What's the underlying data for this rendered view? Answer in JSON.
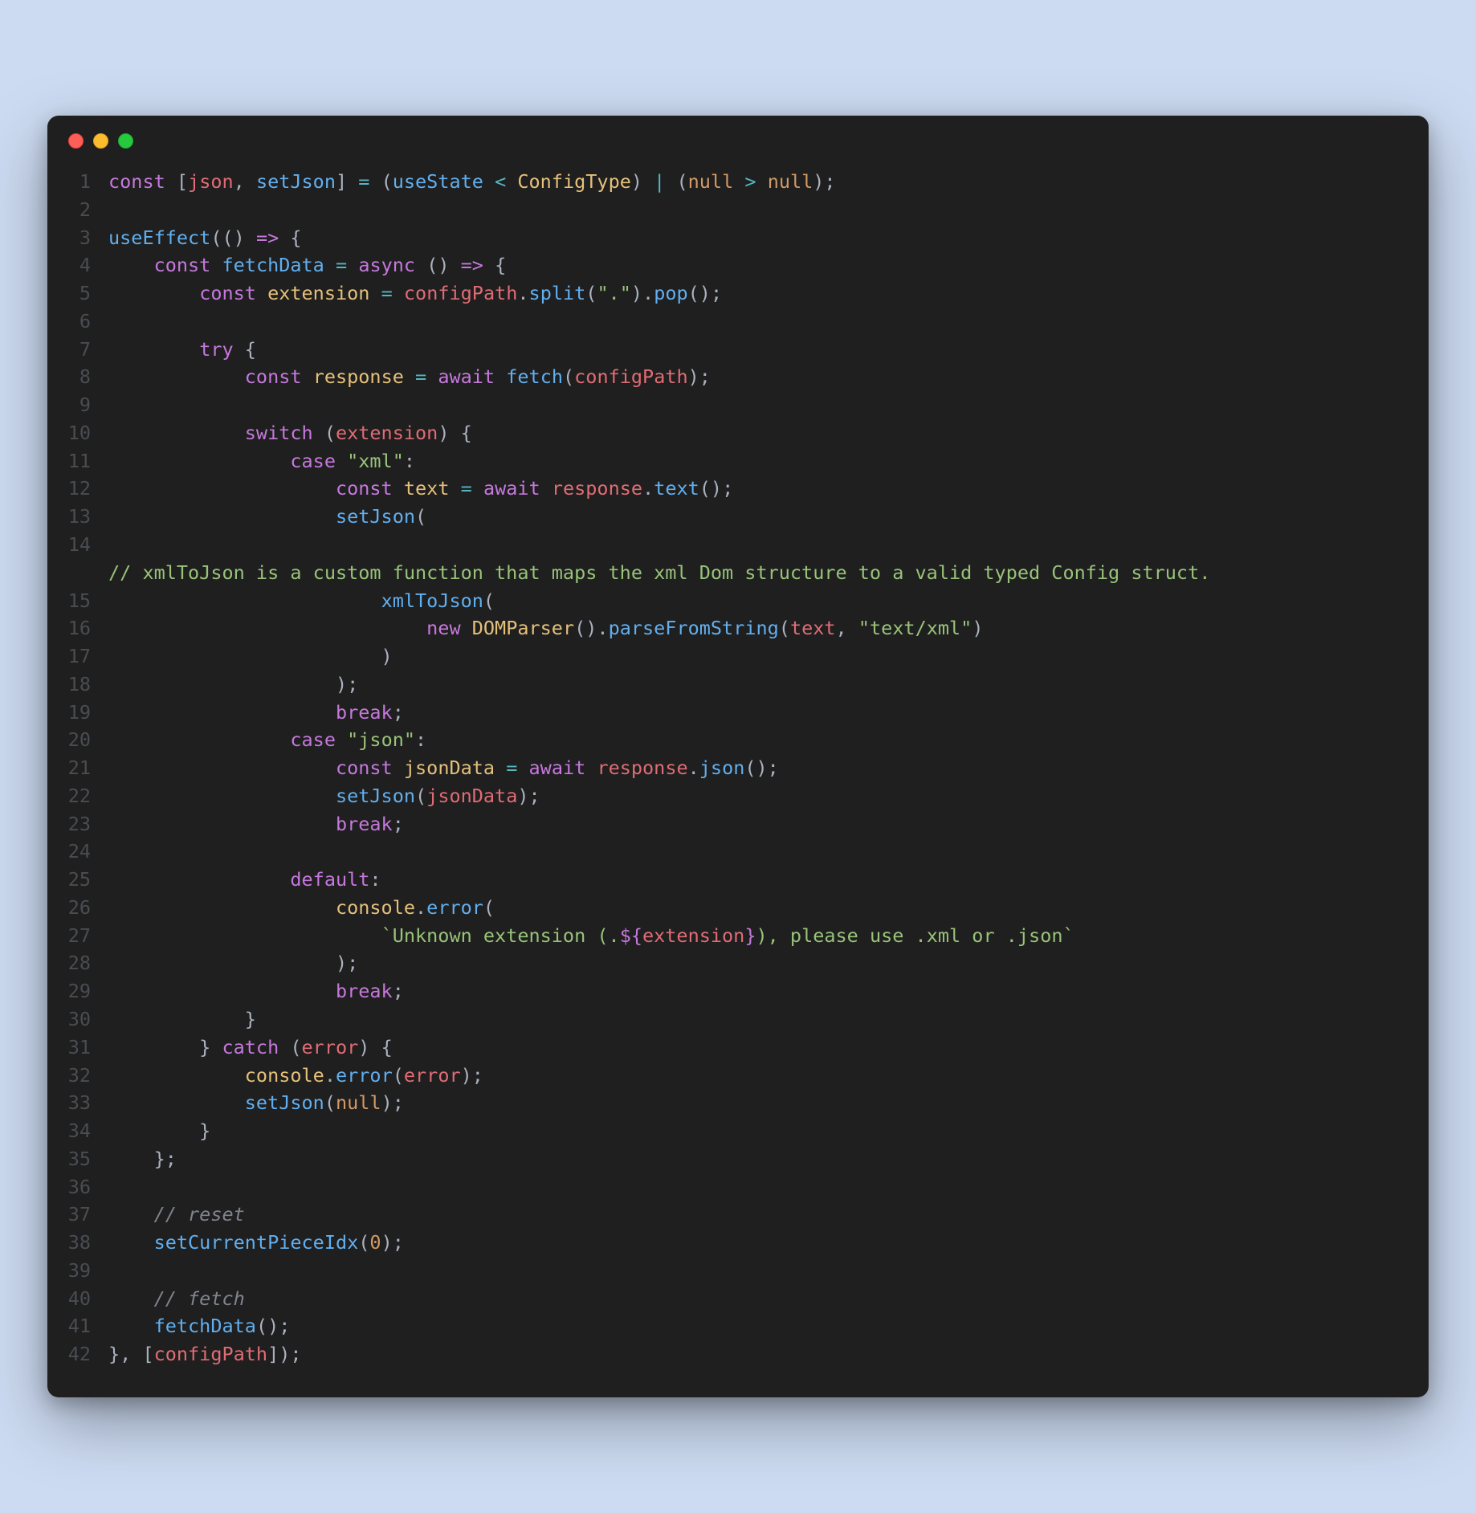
{
  "window": {
    "traffic": {
      "red": "#fb5f57",
      "yellow": "#fdbc2e",
      "green": "#27c93f"
    }
  },
  "code": {
    "lines": [
      {
        "n": "1",
        "tokens": [
          {
            "c": "kw",
            "t": "const"
          },
          {
            "c": "pn",
            "t": " ["
          },
          {
            "c": "red",
            "t": "json"
          },
          {
            "c": "pn",
            "t": ", "
          },
          {
            "c": "fn",
            "t": "setJson"
          },
          {
            "c": "pn",
            "t": "] "
          },
          {
            "c": "op",
            "t": "="
          },
          {
            "c": "pn",
            "t": " ("
          },
          {
            "c": "fn",
            "t": "useState"
          },
          {
            "c": "pn",
            "t": " "
          },
          {
            "c": "op",
            "t": "<"
          },
          {
            "c": "pn",
            "t": " "
          },
          {
            "c": "id",
            "t": "ConfigType"
          },
          {
            "c": "pn",
            "t": ") "
          },
          {
            "c": "op",
            "t": "|"
          },
          {
            "c": "pn",
            "t": " ("
          },
          {
            "c": "num",
            "t": "null"
          },
          {
            "c": "pn",
            "t": " "
          },
          {
            "c": "op",
            "t": ">"
          },
          {
            "c": "pn",
            "t": " "
          },
          {
            "c": "num",
            "t": "null"
          },
          {
            "c": "pn",
            "t": ");"
          }
        ]
      },
      {
        "n": "2",
        "tokens": [
          {
            "c": "pn",
            "t": ""
          }
        ]
      },
      {
        "n": "3",
        "tokens": [
          {
            "c": "fn",
            "t": "useEffect"
          },
          {
            "c": "pn",
            "t": "(() "
          },
          {
            "c": "kw",
            "t": "=>"
          },
          {
            "c": "pn",
            "t": " {"
          }
        ]
      },
      {
        "n": "4",
        "tokens": [
          {
            "c": "pn",
            "t": "    "
          },
          {
            "c": "kw",
            "t": "const"
          },
          {
            "c": "pn",
            "t": " "
          },
          {
            "c": "fn",
            "t": "fetchData"
          },
          {
            "c": "pn",
            "t": " "
          },
          {
            "c": "op",
            "t": "="
          },
          {
            "c": "pn",
            "t": " "
          },
          {
            "c": "kw",
            "t": "async"
          },
          {
            "c": "pn",
            "t": " () "
          },
          {
            "c": "kw",
            "t": "=>"
          },
          {
            "c": "pn",
            "t": " {"
          }
        ]
      },
      {
        "n": "5",
        "tokens": [
          {
            "c": "pn",
            "t": "        "
          },
          {
            "c": "kw",
            "t": "const"
          },
          {
            "c": "pn",
            "t": " "
          },
          {
            "c": "id",
            "t": "extension"
          },
          {
            "c": "pn",
            "t": " "
          },
          {
            "c": "op",
            "t": "="
          },
          {
            "c": "pn",
            "t": " "
          },
          {
            "c": "red",
            "t": "configPath"
          },
          {
            "c": "pn",
            "t": "."
          },
          {
            "c": "fn",
            "t": "split"
          },
          {
            "c": "pn",
            "t": "("
          },
          {
            "c": "str",
            "t": "\".\""
          },
          {
            "c": "pn",
            "t": ")."
          },
          {
            "c": "fn",
            "t": "pop"
          },
          {
            "c": "pn",
            "t": "();"
          }
        ]
      },
      {
        "n": "6",
        "tokens": [
          {
            "c": "pn",
            "t": ""
          }
        ]
      },
      {
        "n": "7",
        "tokens": [
          {
            "c": "pn",
            "t": "        "
          },
          {
            "c": "kw",
            "t": "try"
          },
          {
            "c": "pn",
            "t": " {"
          }
        ]
      },
      {
        "n": "8",
        "tokens": [
          {
            "c": "pn",
            "t": "            "
          },
          {
            "c": "kw",
            "t": "const"
          },
          {
            "c": "pn",
            "t": " "
          },
          {
            "c": "id",
            "t": "response"
          },
          {
            "c": "pn",
            "t": " "
          },
          {
            "c": "op",
            "t": "="
          },
          {
            "c": "pn",
            "t": " "
          },
          {
            "c": "kw",
            "t": "await"
          },
          {
            "c": "pn",
            "t": " "
          },
          {
            "c": "fn",
            "t": "fetch"
          },
          {
            "c": "pn",
            "t": "("
          },
          {
            "c": "red",
            "t": "configPath"
          },
          {
            "c": "pn",
            "t": ");"
          }
        ]
      },
      {
        "n": "9",
        "tokens": [
          {
            "c": "pn",
            "t": ""
          }
        ]
      },
      {
        "n": "10",
        "tokens": [
          {
            "c": "pn",
            "t": "            "
          },
          {
            "c": "kw",
            "t": "switch"
          },
          {
            "c": "pn",
            "t": " ("
          },
          {
            "c": "red",
            "t": "extension"
          },
          {
            "c": "pn",
            "t": ") {"
          }
        ]
      },
      {
        "n": "11",
        "tokens": [
          {
            "c": "pn",
            "t": "                "
          },
          {
            "c": "kw",
            "t": "case"
          },
          {
            "c": "pn",
            "t": " "
          },
          {
            "c": "str",
            "t": "\"xml\""
          },
          {
            "c": "pn",
            "t": ":"
          }
        ]
      },
      {
        "n": "12",
        "tokens": [
          {
            "c": "pn",
            "t": "                    "
          },
          {
            "c": "kw",
            "t": "const"
          },
          {
            "c": "pn",
            "t": " "
          },
          {
            "c": "id",
            "t": "text"
          },
          {
            "c": "pn",
            "t": " "
          },
          {
            "c": "op",
            "t": "="
          },
          {
            "c": "pn",
            "t": " "
          },
          {
            "c": "kw",
            "t": "await"
          },
          {
            "c": "pn",
            "t": " "
          },
          {
            "c": "red",
            "t": "response"
          },
          {
            "c": "pn",
            "t": "."
          },
          {
            "c": "fn",
            "t": "text"
          },
          {
            "c": "pn",
            "t": "();"
          }
        ]
      },
      {
        "n": "13",
        "tokens": [
          {
            "c": "pn",
            "t": "                    "
          },
          {
            "c": "fn",
            "t": "setJson"
          },
          {
            "c": "pn",
            "t": "("
          }
        ]
      },
      {
        "n": "14",
        "tokens": [
          {
            "c": "pn",
            "t": ""
          }
        ]
      },
      {
        "comment": true,
        "tokens": [
          {
            "c": "cm2",
            "t": "// xmlToJson is a custom function that maps the xml Dom structure to a valid typed Config struct."
          }
        ]
      },
      {
        "n": "15",
        "tokens": [
          {
            "c": "pn",
            "t": "                        "
          },
          {
            "c": "fn",
            "t": "xmlToJson"
          },
          {
            "c": "pn",
            "t": "("
          }
        ]
      },
      {
        "n": "16",
        "tokens": [
          {
            "c": "pn",
            "t": "                            "
          },
          {
            "c": "kw",
            "t": "new"
          },
          {
            "c": "pn",
            "t": " "
          },
          {
            "c": "id",
            "t": "DOMParser"
          },
          {
            "c": "pn",
            "t": "()."
          },
          {
            "c": "fn",
            "t": "parseFromString"
          },
          {
            "c": "pn",
            "t": "("
          },
          {
            "c": "red",
            "t": "text"
          },
          {
            "c": "pn",
            "t": ", "
          },
          {
            "c": "str",
            "t": "\"text/xml\""
          },
          {
            "c": "pn",
            "t": ")"
          }
        ]
      },
      {
        "n": "17",
        "tokens": [
          {
            "c": "pn",
            "t": "                        )"
          }
        ]
      },
      {
        "n": "18",
        "tokens": [
          {
            "c": "pn",
            "t": "                    );"
          }
        ]
      },
      {
        "n": "19",
        "tokens": [
          {
            "c": "pn",
            "t": "                    "
          },
          {
            "c": "kw",
            "t": "break"
          },
          {
            "c": "pn",
            "t": ";"
          }
        ]
      },
      {
        "n": "20",
        "tokens": [
          {
            "c": "pn",
            "t": "                "
          },
          {
            "c": "kw",
            "t": "case"
          },
          {
            "c": "pn",
            "t": " "
          },
          {
            "c": "str",
            "t": "\"json\""
          },
          {
            "c": "pn",
            "t": ":"
          }
        ]
      },
      {
        "n": "21",
        "tokens": [
          {
            "c": "pn",
            "t": "                    "
          },
          {
            "c": "kw",
            "t": "const"
          },
          {
            "c": "pn",
            "t": " "
          },
          {
            "c": "id",
            "t": "jsonData"
          },
          {
            "c": "pn",
            "t": " "
          },
          {
            "c": "op",
            "t": "="
          },
          {
            "c": "pn",
            "t": " "
          },
          {
            "c": "kw",
            "t": "await"
          },
          {
            "c": "pn",
            "t": " "
          },
          {
            "c": "red",
            "t": "response"
          },
          {
            "c": "pn",
            "t": "."
          },
          {
            "c": "fn",
            "t": "json"
          },
          {
            "c": "pn",
            "t": "();"
          }
        ]
      },
      {
        "n": "22",
        "tokens": [
          {
            "c": "pn",
            "t": "                    "
          },
          {
            "c": "fn",
            "t": "setJson"
          },
          {
            "c": "pn",
            "t": "("
          },
          {
            "c": "red",
            "t": "jsonData"
          },
          {
            "c": "pn",
            "t": ");"
          }
        ]
      },
      {
        "n": "23",
        "tokens": [
          {
            "c": "pn",
            "t": "                    "
          },
          {
            "c": "kw",
            "t": "break"
          },
          {
            "c": "pn",
            "t": ";"
          }
        ]
      },
      {
        "n": "24",
        "tokens": [
          {
            "c": "pn",
            "t": ""
          }
        ]
      },
      {
        "n": "25",
        "tokens": [
          {
            "c": "pn",
            "t": "                "
          },
          {
            "c": "kw",
            "t": "default"
          },
          {
            "c": "pn",
            "t": ":"
          }
        ]
      },
      {
        "n": "26",
        "tokens": [
          {
            "c": "pn",
            "t": "                    "
          },
          {
            "c": "id",
            "t": "console"
          },
          {
            "c": "pn",
            "t": "."
          },
          {
            "c": "fn",
            "t": "error"
          },
          {
            "c": "pn",
            "t": "("
          }
        ]
      },
      {
        "n": "27",
        "tokens": [
          {
            "c": "pn",
            "t": "                        "
          },
          {
            "c": "str",
            "t": "`Unknown extension (."
          },
          {
            "c": "kw",
            "t": "${"
          },
          {
            "c": "red",
            "t": "extension"
          },
          {
            "c": "kw",
            "t": "}"
          },
          {
            "c": "str",
            "t": "), please use .xml or .json`"
          }
        ]
      },
      {
        "n": "28",
        "tokens": [
          {
            "c": "pn",
            "t": "                    );"
          }
        ]
      },
      {
        "n": "29",
        "tokens": [
          {
            "c": "pn",
            "t": "                    "
          },
          {
            "c": "kw",
            "t": "break"
          },
          {
            "c": "pn",
            "t": ";"
          }
        ]
      },
      {
        "n": "30",
        "tokens": [
          {
            "c": "pn",
            "t": "            }"
          }
        ]
      },
      {
        "n": "31",
        "tokens": [
          {
            "c": "pn",
            "t": "        } "
          },
          {
            "c": "kw",
            "t": "catch"
          },
          {
            "c": "pn",
            "t": " ("
          },
          {
            "c": "red",
            "t": "error"
          },
          {
            "c": "pn",
            "t": ") {"
          }
        ]
      },
      {
        "n": "32",
        "tokens": [
          {
            "c": "pn",
            "t": "            "
          },
          {
            "c": "id",
            "t": "console"
          },
          {
            "c": "pn",
            "t": "."
          },
          {
            "c": "fn",
            "t": "error"
          },
          {
            "c": "pn",
            "t": "("
          },
          {
            "c": "red",
            "t": "error"
          },
          {
            "c": "pn",
            "t": ");"
          }
        ]
      },
      {
        "n": "33",
        "tokens": [
          {
            "c": "pn",
            "t": "            "
          },
          {
            "c": "fn",
            "t": "setJson"
          },
          {
            "c": "pn",
            "t": "("
          },
          {
            "c": "num",
            "t": "null"
          },
          {
            "c": "pn",
            "t": ");"
          }
        ]
      },
      {
        "n": "34",
        "tokens": [
          {
            "c": "pn",
            "t": "        }"
          }
        ]
      },
      {
        "n": "35",
        "tokens": [
          {
            "c": "pn",
            "t": "    };"
          }
        ]
      },
      {
        "n": "36",
        "tokens": [
          {
            "c": "pn",
            "t": ""
          }
        ]
      },
      {
        "n": "37",
        "tokens": [
          {
            "c": "pn",
            "t": "    "
          },
          {
            "c": "cm",
            "t": "// reset"
          }
        ]
      },
      {
        "n": "38",
        "tokens": [
          {
            "c": "pn",
            "t": "    "
          },
          {
            "c": "fn",
            "t": "setCurrentPieceIdx"
          },
          {
            "c": "pn",
            "t": "("
          },
          {
            "c": "num",
            "t": "0"
          },
          {
            "c": "pn",
            "t": ");"
          }
        ]
      },
      {
        "n": "39",
        "tokens": [
          {
            "c": "pn",
            "t": ""
          }
        ]
      },
      {
        "n": "40",
        "tokens": [
          {
            "c": "pn",
            "t": "    "
          },
          {
            "c": "cm",
            "t": "// fetch"
          }
        ]
      },
      {
        "n": "41",
        "tokens": [
          {
            "c": "pn",
            "t": "    "
          },
          {
            "c": "fn",
            "t": "fetchData"
          },
          {
            "c": "pn",
            "t": "();"
          }
        ]
      },
      {
        "n": "42",
        "tokens": [
          {
            "c": "pn",
            "t": "}, ["
          },
          {
            "c": "red",
            "t": "configPath"
          },
          {
            "c": "pn",
            "t": "]);"
          }
        ]
      }
    ]
  }
}
